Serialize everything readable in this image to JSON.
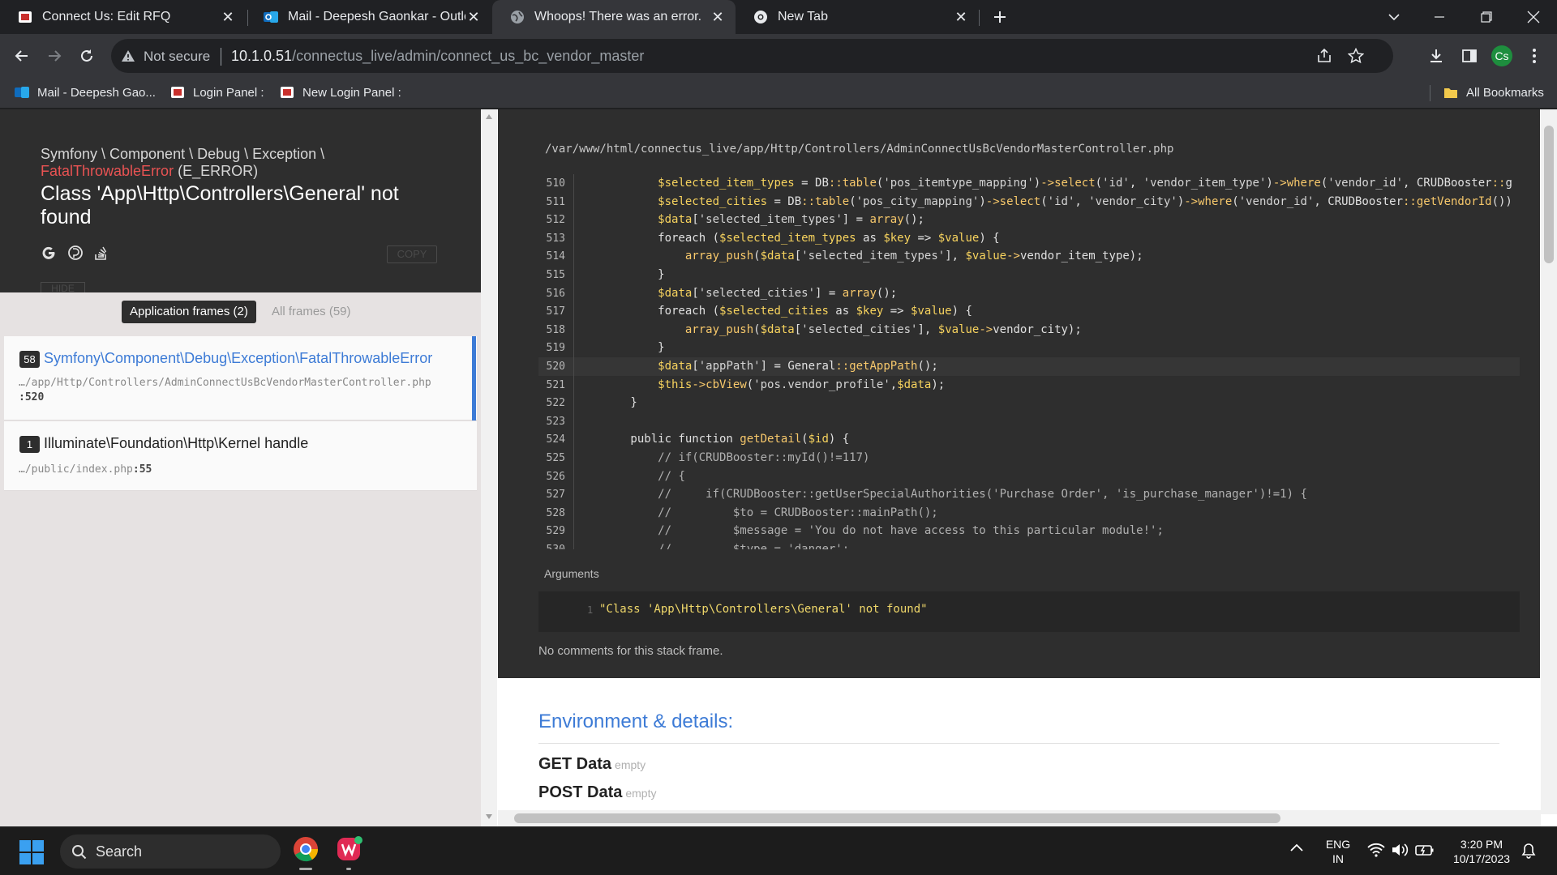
{
  "browser": {
    "tabs": [
      {
        "title": "Connect Us: Edit RFQ",
        "favicon": "connectus-favicon",
        "active": false
      },
      {
        "title": "Mail - Deepesh Gaonkar - Outlook",
        "favicon": "outlook-favicon",
        "active": false
      },
      {
        "title": "Whoops! There was an error.",
        "favicon": "globe-favicon",
        "active": true
      },
      {
        "title": "New Tab",
        "favicon": "chrome-favicon",
        "active": false
      }
    ],
    "security_label": "Not secure",
    "url_host": "10.1.0.51",
    "url_path": "/connectus_live/admin/connect_us_bc_vendor_master",
    "profile_initials": "Cs",
    "bookmarks": [
      {
        "label": "Mail - Deepesh Gao...",
        "icon": "outlook-icon"
      },
      {
        "label": "Login Panel :",
        "icon": "connectus-icon"
      },
      {
        "label": "New Login Panel :",
        "icon": "connectus-icon"
      }
    ],
    "all_bookmarks": "All Bookmarks"
  },
  "exception": {
    "namespace": "Symfony \\ Component \\ Debug \\ Exception \\",
    "class_name": "FatalThrowableError",
    "error_type": "(E_ERROR)",
    "message": "Class 'App\\Http\\Controllers\\General' not found",
    "copy_label": "COPY",
    "hide_label": "HIDE",
    "icons": [
      "google-icon",
      "duckduckgo-icon",
      "stackoverflow-icon"
    ]
  },
  "frames_tabs": {
    "application": "Application frames (2)",
    "all": "All frames (59)"
  },
  "frames": [
    {
      "number": "58",
      "class": "Symfony\\Component\\Debug\\Exception\\FatalThrowableError",
      "file": "…/app/Http/Controllers/AdminConnectUsBcVendorMasterController.php",
      "line": ":520"
    },
    {
      "number": "1",
      "class": "Illuminate\\Foundation\\Http\\Kernel handle",
      "file": "…/public/index.php",
      "line": ":55"
    }
  ],
  "code": {
    "path": "/var/www/html/connectus_live/app/Http/Controllers/AdminConnectUsBcVendorMasterController.php",
    "highlighted_line": "520",
    "lines": [
      {
        "n": "510",
        "text": "            $selected_item_types = DB::table('pos_itemtype_mapping')->select('id', 'vendor_item_type')->where('vendor_id', CRUDBooster::g"
      },
      {
        "n": "511",
        "text": "            $selected_cities = DB::table('pos_city_mapping')->select('id', 'vendor_city')->where('vendor_id', CRUDBooster::getVendorId())"
      },
      {
        "n": "512",
        "text": "            $data['selected_item_types'] = array();"
      },
      {
        "n": "513",
        "text": "            foreach ($selected_item_types as $key => $value) {"
      },
      {
        "n": "514",
        "text": "                array_push($data['selected_item_types'], $value->vendor_item_type);"
      },
      {
        "n": "515",
        "text": "            }"
      },
      {
        "n": "516",
        "text": "            $data['selected_cities'] = array();"
      },
      {
        "n": "517",
        "text": "            foreach ($selected_cities as $key => $value) {"
      },
      {
        "n": "518",
        "text": "                array_push($data['selected_cities'], $value->vendor_city);"
      },
      {
        "n": "519",
        "text": "            }"
      },
      {
        "n": "520",
        "text": "            $data['appPath'] = General::getAppPath();"
      },
      {
        "n": "521",
        "text": "            $this->cbView('pos.vendor_profile',$data);"
      },
      {
        "n": "522",
        "text": "        }"
      },
      {
        "n": "523",
        "text": ""
      },
      {
        "n": "524",
        "text": "        public function getDetail($id) {"
      },
      {
        "n": "525",
        "text": "            // if(CRUDBooster::myId()!=117)"
      },
      {
        "n": "526",
        "text": "            // {"
      },
      {
        "n": "527",
        "text": "            //     if(CRUDBooster::getUserSpecialAuthorities('Purchase Order', 'is_purchase_manager')!=1) {"
      },
      {
        "n": "528",
        "text": "            //         $to = CRUDBooster::mainPath();"
      },
      {
        "n": "529",
        "text": "            //         $message = 'You do not have access to this particular module!';"
      },
      {
        "n": "530",
        "text": "            //         $type = 'danger';"
      }
    ]
  },
  "arguments": {
    "label": "Arguments",
    "index": "1",
    "value": "\"Class 'App\\Http\\Controllers\\General' not found\""
  },
  "no_comments": "No comments for this stack frame.",
  "environment": {
    "title": "Environment & details:",
    "rows": [
      {
        "label": "GET Data",
        "value": "empty"
      },
      {
        "label": "POST Data",
        "value": "empty"
      }
    ]
  },
  "taskbar": {
    "search_placeholder": "Search",
    "lang_top": "ENG",
    "lang_bottom": "IN",
    "time": "3:20 PM",
    "date": "10/17/2023"
  }
}
